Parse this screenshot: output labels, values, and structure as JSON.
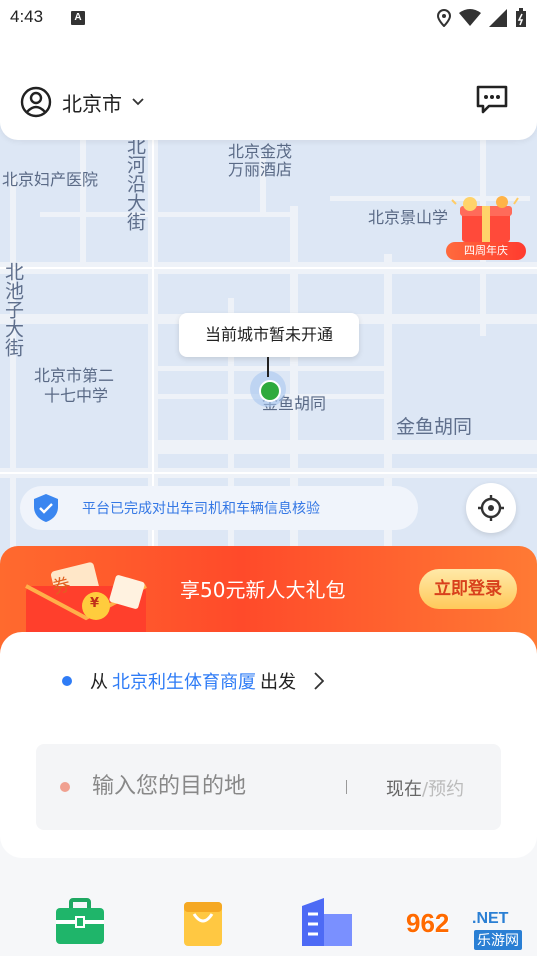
{
  "status_bar": {
    "time": "4:43",
    "notification_badge": "A",
    "icons": [
      "location-icon",
      "wifi-icon",
      "signal-icon",
      "battery-icon"
    ]
  },
  "header": {
    "city": "北京市",
    "icons": [
      "user-avatar-icon",
      "chevron-down-icon",
      "message-icon"
    ]
  },
  "map": {
    "labels": {
      "maternity_hospital": "北京妇产医院",
      "jinmao_line1": "北京金茂",
      "jinmao_line2": "万丽酒店",
      "beiheyan": "北河沿大街",
      "jingshan": "北京景山学",
      "beichizi": "北池子大街",
      "school_line1": "北京市第二",
      "school_line2": "十七中学",
      "jinyu_small": "金鱼胡同",
      "jinyu_big": "金鱼胡同"
    },
    "anniversary_badge": "四周年庆",
    "city_tip": "当前城市暂未开通",
    "verify_text": "平台已完成对出车司机和车辆信息核验"
  },
  "promo": {
    "title": "享50元新人大礼包",
    "button": "立即登录",
    "coupon_text": "券",
    "coin_text": "¥"
  },
  "trip": {
    "from_prefix": "从",
    "from_place": "北京利生体育商厦",
    "from_suffix": "出发",
    "dest_placeholder": "输入您的目的地",
    "time_now": "现在",
    "time_slash": "/",
    "time_reserve": "预约"
  },
  "bottom_icons": [
    "briefcase-icon",
    "shopping-bag-icon",
    "building-icon"
  ],
  "watermark": {
    "num": "962",
    "net": ".NET",
    "sub": "乐游网"
  },
  "colors": {
    "accent_blue": "#2f7cf6",
    "promo_orange": "#ff5a2c",
    "pin_green": "#2eaa3c"
  }
}
